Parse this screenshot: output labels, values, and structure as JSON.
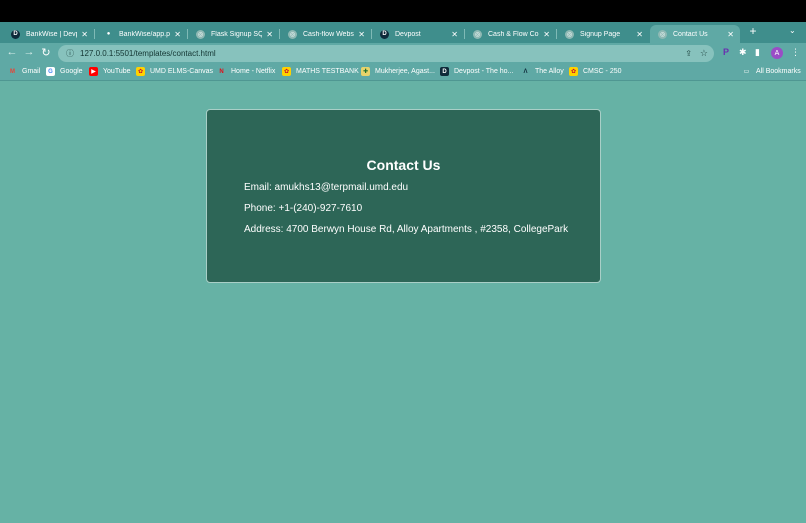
{
  "browser": {
    "tabs": [
      {
        "title": "BankWise | Devpo",
        "icon": "devpost-icon",
        "icon_char": "D",
        "icon_bg": "#0e2a3a",
        "active": false
      },
      {
        "title": "BankWise/app.py",
        "icon": "github-icon",
        "icon_char": "●",
        "icon_bg": "#3f8e8c",
        "active": false
      },
      {
        "title": "Flask Signup SQL",
        "icon": "globe-icon",
        "icon_char": "◎",
        "icon_bg": "#8fb9b4",
        "active": false
      },
      {
        "title": "Cash-flow Websit",
        "icon": "globe-icon",
        "icon_char": "◎",
        "icon_bg": "#8fb9b4",
        "active": false
      },
      {
        "title": "Devpost",
        "icon": "devpost-icon",
        "icon_char": "D",
        "icon_bg": "#0e2a3a",
        "active": false
      },
      {
        "title": "Cash & Flow Cons",
        "icon": "globe-icon",
        "icon_char": "◎",
        "icon_bg": "#8fb9b4",
        "active": false
      },
      {
        "title": "Signup Page",
        "icon": "globe-icon",
        "icon_char": "◎",
        "icon_bg": "#8fb9b4",
        "active": false
      },
      {
        "title": "Contact Us",
        "icon": "globe-icon",
        "icon_char": "◎",
        "icon_bg": "#8fb9b4",
        "active": true
      }
    ],
    "address": "127.0.0.1:5501/templates/contact.html",
    "profile_initial": "A",
    "bookmarks": [
      {
        "label": "Gmail",
        "icon": "gmail-icon",
        "icon_char": "M",
        "icon_color": "#ea4335",
        "icon_bg": "transparent"
      },
      {
        "label": "Google",
        "icon": "google-icon",
        "icon_char": "G",
        "icon_color": "#4285f4",
        "icon_bg": "#ffffff"
      },
      {
        "label": "YouTube",
        "icon": "youtube-icon",
        "icon_char": "▶",
        "icon_color": "#ffffff",
        "icon_bg": "#ff0000"
      },
      {
        "label": "UMD ELMS-Canvas",
        "icon": "umd-icon",
        "icon_char": "✿",
        "icon_color": "#c8102e",
        "icon_bg": "#ffd200"
      },
      {
        "label": "Home - Netflix",
        "icon": "netflix-icon",
        "icon_char": "N",
        "icon_color": "#e50914",
        "icon_bg": "transparent"
      },
      {
        "label": "MATHS TESTBANK",
        "icon": "umd-icon",
        "icon_char": "✿",
        "icon_color": "#c8102e",
        "icon_bg": "#ffd200"
      },
      {
        "label": "Mukherjee, Agast...",
        "icon": "plus-icon",
        "icon_char": "✚",
        "icon_color": "#1b6e2c",
        "icon_bg": "#e7d36a"
      },
      {
        "label": "Devpost - The ho...",
        "icon": "devpost-icon",
        "icon_char": "D",
        "icon_color": "#ffffff",
        "icon_bg": "#0e2a3a"
      },
      {
        "label": "The Alloy",
        "icon": "alloy-icon",
        "icon_char": "Λ",
        "icon_color": "#0e2a3a",
        "icon_bg": "transparent"
      },
      {
        "label": "CMSC - 250",
        "icon": "umd-icon",
        "icon_char": "✿",
        "icon_color": "#c8102e",
        "icon_bg": "#ffd200"
      }
    ],
    "all_bookmarks_label": "All Bookmarks"
  },
  "contact": {
    "title": "Contact Us",
    "email": "Email: amukhs13@terpmail.umd.edu",
    "phone": "Phone: +1-(240)-927-7610",
    "address": "Address: 4700 Berwyn House Rd, Alloy Apartments , #2358, CollegePark"
  }
}
